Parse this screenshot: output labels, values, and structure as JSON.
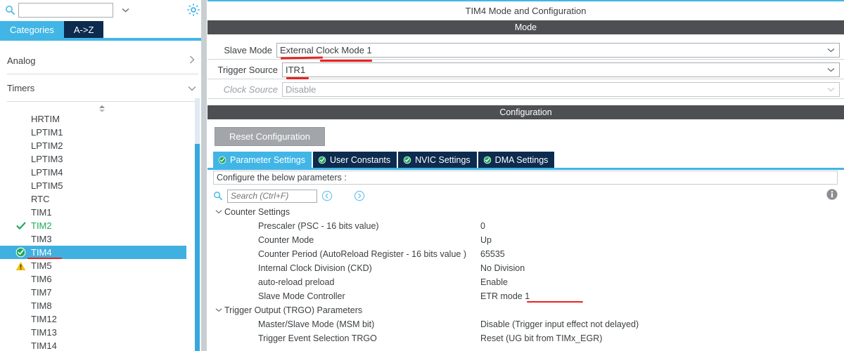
{
  "sidebar": {
    "search": {
      "value": "",
      "placeholder": "",
      "icon": "search-icon"
    },
    "gear_icon": "gear-icon",
    "tabs": [
      {
        "label": "Categories",
        "active": true
      },
      {
        "label": "A->Z",
        "active": false
      }
    ],
    "groups": [
      {
        "label": "Analog",
        "expanded": false,
        "chevron": "chevron-right-icon"
      },
      {
        "label": "Timers",
        "expanded": true,
        "chevron": "chevron-down-icon"
      }
    ],
    "tree_items": [
      {
        "label": "HRTIM",
        "state": "none"
      },
      {
        "label": "LPTIM1",
        "state": "none"
      },
      {
        "label": "LPTIM2",
        "state": "none"
      },
      {
        "label": "LPTIM3",
        "state": "none"
      },
      {
        "label": "LPTIM4",
        "state": "none"
      },
      {
        "label": "LPTIM5",
        "state": "none"
      },
      {
        "label": "RTC",
        "state": "none"
      },
      {
        "label": "TIM1",
        "state": "none"
      },
      {
        "label": "TIM2",
        "state": "check"
      },
      {
        "label": "TIM3",
        "state": "none"
      },
      {
        "label": "TIM4",
        "state": "check-filled",
        "selected": true,
        "annotated": true
      },
      {
        "label": "TIM5",
        "state": "warning"
      },
      {
        "label": "TIM6",
        "state": "none"
      },
      {
        "label": "TIM7",
        "state": "none"
      },
      {
        "label": "TIM8",
        "state": "none"
      },
      {
        "label": "TIM12",
        "state": "none"
      },
      {
        "label": "TIM13",
        "state": "none"
      },
      {
        "label": "TIM14",
        "state": "none"
      }
    ]
  },
  "panel": {
    "title": "TIM4 Mode and Configuration",
    "mode_section_label": "Mode",
    "config_section_label": "Configuration",
    "mode_rows": [
      {
        "label": "Slave Mode",
        "value": "External Clock Mode 1",
        "disabled": false,
        "annotated": true
      },
      {
        "label": "Trigger Source",
        "value": "ITR1",
        "disabled": false,
        "annotated": true
      },
      {
        "label": "Clock Source",
        "value": "Disable",
        "disabled": true,
        "annotated": false
      }
    ],
    "reset_button": "Reset Configuration",
    "config_tabs": [
      {
        "label": "Parameter Settings",
        "active": true,
        "icon": "green-check-icon"
      },
      {
        "label": "User Constants",
        "active": false,
        "icon": "green-check-icon"
      },
      {
        "label": "NVIC Settings",
        "active": false,
        "icon": "green-check-icon"
      },
      {
        "label": "DMA Settings",
        "active": false,
        "icon": "green-check-icon"
      }
    ],
    "configure_hint": "Configure the below parameters :",
    "param_search": {
      "value": "",
      "placeholder": "Search (Ctrl+F)",
      "icon": "search-icon"
    },
    "nav_back_icon": "circle-left-arrow-icon",
    "nav_forward_icon": "circle-right-arrow-icon",
    "info_icon": "info-icon",
    "param_groups": [
      {
        "label": "Counter Settings",
        "expanded": true,
        "rows": [
          {
            "name": "Prescaler (PSC - 16 bits value)",
            "value": "0",
            "annotated": false
          },
          {
            "name": "Counter Mode",
            "value": "Up",
            "annotated": false
          },
          {
            "name": "Counter Period (AutoReload Register - 16 bits value )",
            "value": "65535",
            "annotated": false
          },
          {
            "name": "Internal Clock Division (CKD)",
            "value": "No Division",
            "annotated": false
          },
          {
            "name": "auto-reload preload",
            "value": "Enable",
            "annotated": false
          },
          {
            "name": "Slave Mode Controller",
            "value": "ETR mode 1",
            "annotated": true
          }
        ]
      },
      {
        "label": "Trigger Output (TRGO) Parameters",
        "expanded": true,
        "rows": [
          {
            "name": "Master/Slave Mode (MSM bit)",
            "value": "Disable (Trigger input effect not delayed)",
            "annotated": false
          },
          {
            "name": "Trigger Event Selection TRGO",
            "value": "Reset (UG bit from TIMx_EGR)",
            "annotated": false
          }
        ]
      }
    ]
  },
  "colors": {
    "accent_blue": "#41b6e6",
    "dark_navy": "#0d2b4e",
    "section_gray": "#4d4f53",
    "annotation_red": "#e8231f",
    "ok_green": "#1faa59",
    "warn_yellow": "#f2c21b",
    "selection_blue": "#3fb0e0"
  }
}
